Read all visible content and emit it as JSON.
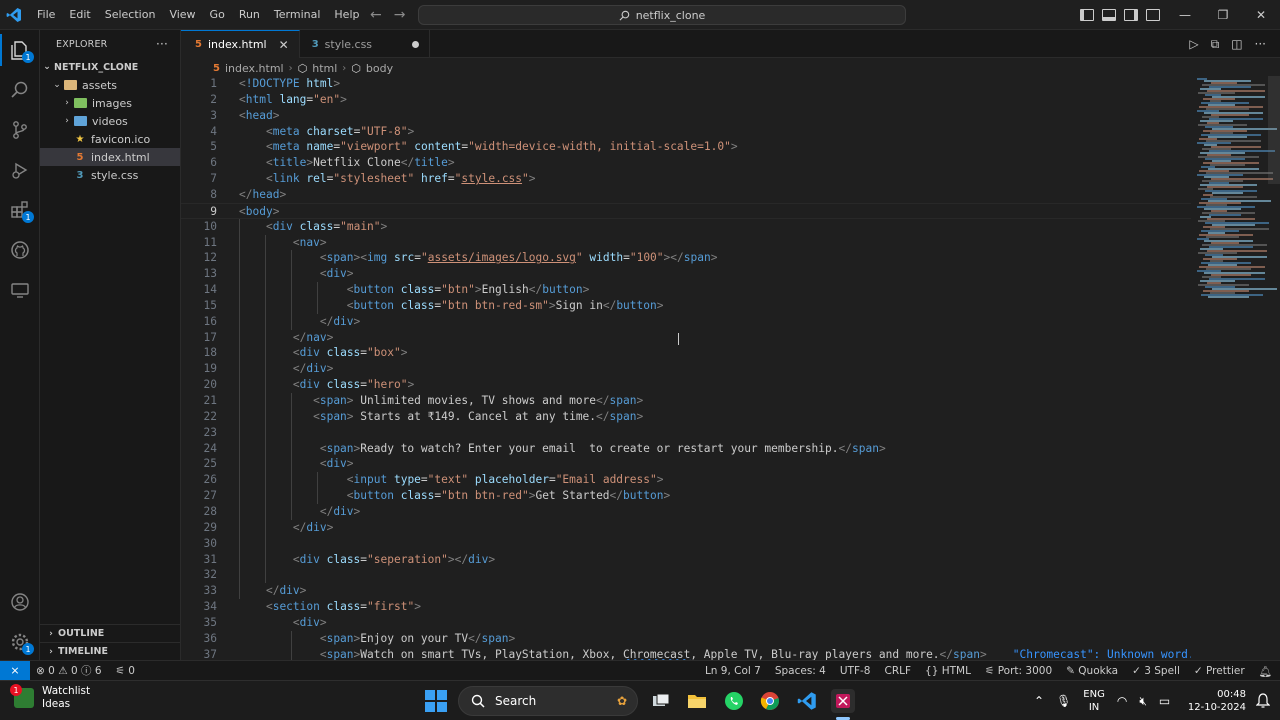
{
  "window": {
    "menu": [
      "File",
      "Edit",
      "Selection",
      "View",
      "Go",
      "Run",
      "Terminal",
      "Help"
    ],
    "search_text": "netflix_clone"
  },
  "sidebar": {
    "title": "EXPLORER",
    "more": "···",
    "project": "NETFLIX_CLONE",
    "tree": [
      {
        "label": "assets",
        "depth": 1,
        "kind": "folder-open"
      },
      {
        "label": "images",
        "depth": 2,
        "kind": "folder"
      },
      {
        "label": "videos",
        "depth": 2,
        "kind": "folder"
      },
      {
        "label": "favicon.ico",
        "depth": 2,
        "kind": "star"
      },
      {
        "label": "index.html",
        "depth": 2,
        "kind": "html",
        "selected": true
      },
      {
        "label": "style.css",
        "depth": 2,
        "kind": "css"
      }
    ],
    "outline": "OUTLINE",
    "timeline": "TIMELINE"
  },
  "tabs": [
    {
      "label": "index.html",
      "active": true
    },
    {
      "label": "style.css",
      "active": false,
      "modified": true
    }
  ],
  "breadcrumbs": [
    "index.html",
    "html",
    "body"
  ],
  "code": {
    "current_line": 9,
    "lines": [
      "<!DOCTYPE html>",
      "<html lang=\"en\">",
      "<head>",
      "    <meta charset=\"UTF-8\">",
      "    <meta name=\"viewport\" content=\"width=device-width, initial-scale=1.0\">",
      "    <title>Netflix Clone</title>",
      "    <link rel=\"stylesheet\" href=\"style.css\">",
      "</head>",
      "<body>",
      "    <div class=\"main\">",
      "        <nav>",
      "            <span><img src=\"assets/images/logo.svg\" width=\"100\"></span>",
      "            <div>",
      "                <button class=\"btn\">English</button>",
      "                <button class=\"btn btn-red-sm\">Sign in</button>",
      "            </div>",
      "        </nav>",
      "        <div class=\"box\">",
      "        </div>",
      "        <div class=\"hero\">",
      "           <span> Unlimited movies, TV shows and more</span>",
      "           <span> Starts at ₹149. Cancel at any time.</span>",
      "",
      "            <span>Ready to watch? Enter your email  to create or restart your membership.</span>",
      "            <div>",
      "                <input type=\"text\" placeholder=\"Email address\">",
      "                <button class=\"btn btn-red\">Get Started</button>",
      "            </div>",
      "        </div>",
      "",
      "        <div class=\"seperation\"></div>",
      "",
      "    </div>",
      "    <section class=\"first\">",
      "        <div>",
      "            <span>Enjoy on your TV</span>",
      "            <span>Watch on smart TVs, PlayStation, Xbox, Chromecast, Apple TV, Blu-ray players and more.</span>"
    ],
    "inline_hint": "\"Chromecast\": Unknown word."
  },
  "statusbar": {
    "errors": "0",
    "warnings": "0",
    "info": "6",
    "ports_count": "0",
    "position": "Ln 9, Col 7",
    "spaces": "Spaces: 4",
    "encoding": "UTF-8",
    "eol": "CRLF",
    "language": "HTML",
    "port": "Port: 3000",
    "quokka": "Quokka",
    "spell": "3 Spell",
    "prettier": "Prettier"
  },
  "taskbar": {
    "weather_title": "Watchlist",
    "weather_sub": "Ideas",
    "weather_badge": "1",
    "search_label": "Search",
    "lang_top": "ENG",
    "lang_bottom": "IN",
    "time": "00:48",
    "date": "12-10-2024"
  },
  "colors": {
    "accent": "#0078d4",
    "tag": "#569cd6",
    "attr": "#9cdcfe",
    "string": "#ce9178",
    "punct": "#808080"
  }
}
